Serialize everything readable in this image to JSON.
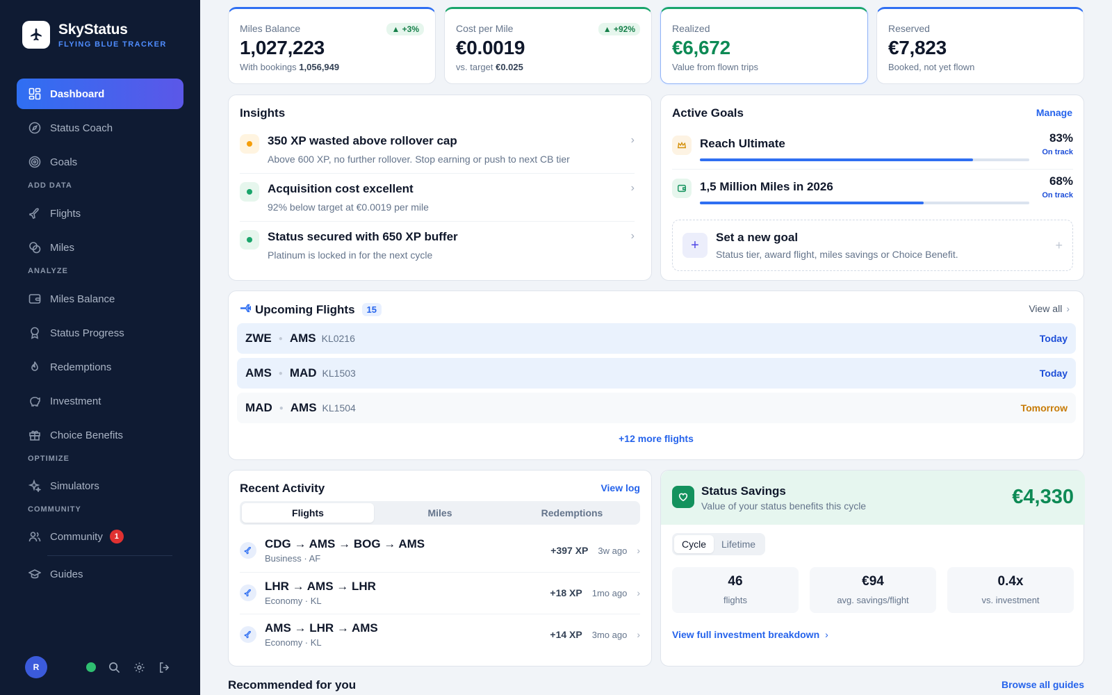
{
  "app": {
    "name": "SkyStatus",
    "subtitle": "FLYING BLUE TRACKER"
  },
  "sidebar": {
    "items": [
      {
        "label": "Dashboard",
        "icon": "dashboard-grid-icon",
        "active": true
      },
      {
        "label": "Status Coach",
        "icon": "compass-icon"
      },
      {
        "label": "Goals",
        "icon": "target-icon"
      },
      {
        "label": "Flights",
        "icon": "plane-icon"
      },
      {
        "label": "Miles",
        "icon": "coins-icon"
      },
      {
        "label": "Miles Balance",
        "icon": "wallet-icon"
      },
      {
        "label": "Status Progress",
        "icon": "award-icon"
      },
      {
        "label": "Redemptions",
        "icon": "flame-icon"
      },
      {
        "label": "Investment",
        "icon": "piggy-bank-icon"
      },
      {
        "label": "Choice Benefits",
        "icon": "gift-icon"
      },
      {
        "label": "Simulators",
        "icon": "sparkles-icon"
      },
      {
        "label": "Community",
        "icon": "users-icon",
        "badge": "1"
      },
      {
        "label": "Guides",
        "icon": "graduation-cap-icon"
      }
    ],
    "sections": {
      "add_data": "ADD DATA",
      "analyze": "ANALYZE",
      "optimize": "OPTIMIZE",
      "community": "COMMUNITY"
    },
    "footer": {
      "avatar_initial": "R",
      "icons": [
        "online-status-icon",
        "search-icon",
        "settings-gear-icon",
        "logout-icon"
      ]
    }
  },
  "kpis": [
    {
      "label": "Miles Balance",
      "value": "1,027,223",
      "sub_prefix": "With bookings",
      "sub_value": "1,056,949",
      "trend": "▲ +3%"
    },
    {
      "label": "Cost per Mile",
      "value": "€0.0019",
      "sub_prefix": "vs. target",
      "sub_value": "€0.025",
      "trend": "▲ +92%"
    },
    {
      "label": "Realized",
      "value": "€6,672",
      "sub": "Value from flown trips"
    },
    {
      "label": "Reserved",
      "value": "€7,823",
      "sub": "Booked, not yet flown"
    }
  ],
  "insights": {
    "title": "Insights",
    "items": [
      {
        "title": "350 XP wasted above rollover cap",
        "desc": "Above 600 XP, no further rollover. Stop earning or push to next CB tier",
        "status": "warning"
      },
      {
        "title": "Acquisition cost excellent",
        "desc": "92% below target at €0.0019 per mile",
        "status": "success"
      },
      {
        "title": "Status secured with 650 XP buffer",
        "desc": "Platinum is locked in for the next cycle",
        "status": "success"
      }
    ]
  },
  "goals": {
    "title": "Active Goals",
    "manage_label": "Manage",
    "items": [
      {
        "title": "Reach Ultimate",
        "percent_label": "83%",
        "progress": 0.83,
        "status": "On track",
        "icon": "crown-icon"
      },
      {
        "title": "1,5 Million Miles in 2026",
        "percent_label": "68%",
        "progress": 0.68,
        "status": "On track",
        "icon": "wallet-icon"
      }
    ],
    "new_goal": {
      "title": "Set a new goal",
      "desc": "Status tier, award flight, miles savings or Choice Benefit."
    }
  },
  "upcoming": {
    "title": "Upcoming Flights",
    "count": "15",
    "view_all_label": "View all",
    "flights": [
      {
        "from": "ZWE",
        "to": "AMS",
        "number": "KL0216",
        "when": "Today"
      },
      {
        "from": "AMS",
        "to": "MAD",
        "number": "KL1503",
        "when": "Today"
      },
      {
        "from": "MAD",
        "to": "AMS",
        "number": "KL1504",
        "when": "Tomorrow"
      }
    ],
    "more_label": "+12 more flights"
  },
  "activity": {
    "title": "Recent Activity",
    "view_log_label": "View log",
    "tabs": [
      "Flights",
      "Miles",
      "Redemptions"
    ],
    "active_tab": "Flights",
    "items": [
      {
        "route": "CDG → AMS → BOG → AMS",
        "sub": "Business · AF",
        "xp": "+397 XP",
        "age": "3w ago"
      },
      {
        "route": "LHR → AMS → LHR",
        "sub": "Economy · KL",
        "xp": "+18 XP",
        "age": "1mo ago"
      },
      {
        "route": "AMS → LHR → AMS",
        "sub": "Economy · KL",
        "xp": "+14 XP",
        "age": "3mo ago"
      }
    ]
  },
  "savings": {
    "title": "Status Savings",
    "sub": "Value of your status benefits this cycle",
    "amount": "€4,330",
    "segments": [
      "Cycle",
      "Lifetime"
    ],
    "active_segment": "Cycle",
    "stats": [
      {
        "value": "46",
        "label": "flights"
      },
      {
        "value": "€94",
        "label": "avg. savings/flight"
      },
      {
        "value": "0.4x",
        "label": "vs. investment"
      }
    ],
    "link_label": "View full investment breakdown"
  },
  "recommended": {
    "title": "Recommended for you",
    "browse_label": "Browse all guides"
  },
  "colors": {
    "sidebar_bg": "#0f1b33",
    "accent_blue": "#2f6ff2",
    "success_green": "#0d8a55",
    "warning_amber": "#f59e0b",
    "danger_red": "#e03131"
  }
}
